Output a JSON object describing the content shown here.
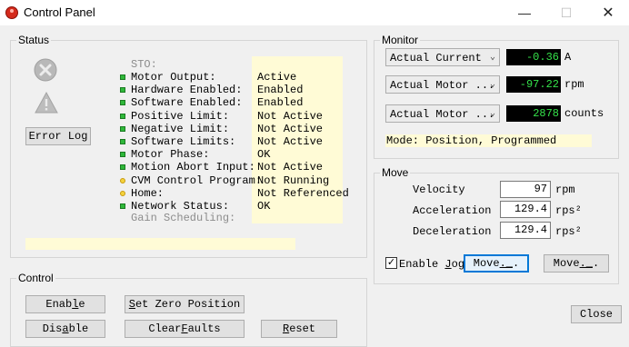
{
  "window": {
    "title": "Control Panel",
    "minimize": "—",
    "maximize": "☐",
    "close": "✕"
  },
  "status": {
    "group_title": "Status",
    "error_log_label": "Error Log",
    "sto_label": "STO:",
    "rows": [
      {
        "label": "Motor Output:",
        "value": "Active",
        "led": "green"
      },
      {
        "label": "Hardware Enabled:",
        "value": "Enabled",
        "led": "green"
      },
      {
        "label": "Software Enabled:",
        "value": "Enabled",
        "led": "green"
      },
      {
        "label": "Positive Limit:",
        "value": "Not Active",
        "led": "green"
      },
      {
        "label": "Negative Limit:",
        "value": "Not Active",
        "led": "green"
      },
      {
        "label": "Software Limits:",
        "value": "Not Active",
        "led": "green"
      },
      {
        "label": "Motor Phase:",
        "value": "OK",
        "led": "green"
      },
      {
        "label": "Motion Abort Input:",
        "value": "Not Active",
        "led": "green"
      },
      {
        "label": "CVM Control Program:",
        "value": "Not Running",
        "led": "yellow"
      },
      {
        "label": "Home:",
        "value": "Not Referenced",
        "led": "yellow"
      },
      {
        "label": "Network Status:",
        "value": "OK",
        "led": "green"
      }
    ],
    "gain_label": "Gain Scheduling:"
  },
  "control": {
    "group_title": "Control",
    "enable_pre": "Enab",
    "enable_ul": "l",
    "enable_post": "e",
    "set_zero_ul": "S",
    "set_zero_post": "et Zero Position",
    "disable_pre": "Dis",
    "disable_ul": "a",
    "disable_post": "ble",
    "clear_pre": "Clear ",
    "clear_ul": "F",
    "clear_post": "aults",
    "reset_ul": "R",
    "reset_post": "eset"
  },
  "monitor": {
    "group_title": "Monitor",
    "rows": [
      {
        "select": "Actual Current",
        "value": "-0.36",
        "unit": "A"
      },
      {
        "select": "Actual Motor ...",
        "value": "-97.22",
        "unit": "rpm"
      },
      {
        "select": "Actual Motor ...",
        "value": "2878",
        "unit": "counts"
      }
    ],
    "mode": "Mode: Position, Programmed"
  },
  "move": {
    "group_title": "Move",
    "velocity_label": "Velocity",
    "velocity_value": "97",
    "velocity_unit": "rpm",
    "accel_label": "Acceleration",
    "accel_value": "129.4",
    "accel_unit": "rps²",
    "decel_label": "Deceleration",
    "decel_value": "129.4",
    "decel_unit": "rps²",
    "enable_jog_pre": "Enable ",
    "enable_jog_ul": "J",
    "enable_jog_post": "og",
    "enable_jog_checked": true,
    "move1_pre": "Move",
    "move1_ul": "._",
    "move1_post": ".",
    "move2_pre": "Move",
    "move2_ul": "._",
    "move2_post": "."
  },
  "close_label": "Close",
  "icons": {
    "error": "error-x-icon",
    "warning": "warning-triangle-icon",
    "check": "check-icon"
  }
}
